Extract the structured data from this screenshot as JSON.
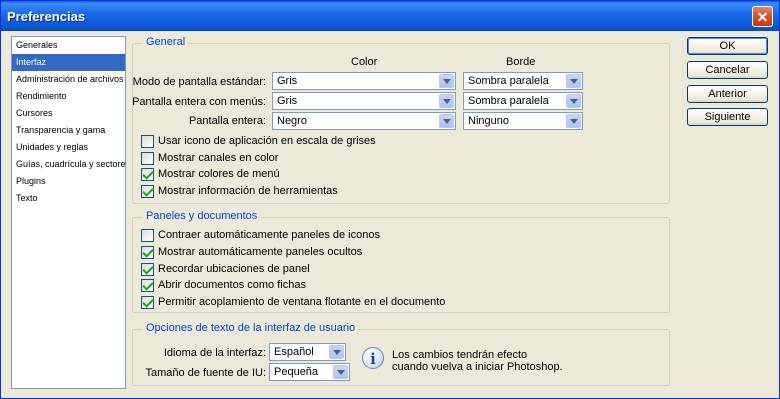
{
  "window": {
    "title": "Preferencias"
  },
  "sidebar": {
    "items": [
      {
        "label": "Generales",
        "active": false
      },
      {
        "label": "Interfaz",
        "active": true
      },
      {
        "label": "Administración de archivos",
        "active": false
      },
      {
        "label": "Rendimiento",
        "active": false
      },
      {
        "label": "Cursores",
        "active": false
      },
      {
        "label": "Transparencia y gama",
        "active": false
      },
      {
        "label": "Unidades y reglas",
        "active": false
      },
      {
        "label": "Guías, cuadrícula y sectores",
        "active": false
      },
      {
        "label": "Plugins",
        "active": false
      },
      {
        "label": "Texto",
        "active": false
      }
    ]
  },
  "buttons": {
    "ok": "OK",
    "cancel": "Cancelar",
    "prev": "Anterior",
    "next": "Siguiente"
  },
  "general": {
    "legend": "General",
    "col_color": "Color",
    "col_borde": "Borde",
    "rows": [
      {
        "label": "Modo de pantalla estándar:",
        "color": "Gris",
        "borde": "Sombra paralela"
      },
      {
        "label": "Pantalla entera con menús:",
        "color": "Gris",
        "borde": "Sombra paralela"
      },
      {
        "label": "Pantalla entera:",
        "color": "Negro",
        "borde": "Ninguno"
      }
    ],
    "checks": [
      {
        "label": "Usar icono de aplicación en escala de grises",
        "checked": false
      },
      {
        "label": "Mostrar canales en color",
        "checked": false
      },
      {
        "label": "Mostrar colores de menú",
        "checked": true
      },
      {
        "label": "Mostrar información de herramientas",
        "checked": true
      }
    ]
  },
  "panels": {
    "legend": "Paneles y documentos",
    "checks": [
      {
        "label": "Contraer automáticamente paneles de iconos",
        "checked": false
      },
      {
        "label": "Mostrar automáticamente paneles ocultos",
        "checked": true
      },
      {
        "label": "Recordar ubicaciones de panel",
        "checked": true
      },
      {
        "label": "Abrir documentos como fichas",
        "checked": true
      },
      {
        "label": "Permitir acoplamiento de ventana flotante en el documento",
        "checked": true
      }
    ]
  },
  "textopts": {
    "legend": "Opciones de texto de la interfaz de usuario",
    "language_label": "Idioma de la interfaz:",
    "language_value": "Español",
    "fontsize_label": "Tamaño de fuente de IU:",
    "fontsize_value": "Pequeña",
    "info_line1": "Los cambios tendrán efecto",
    "info_line2": "cuando vuelva a iniciar Photoshop."
  }
}
